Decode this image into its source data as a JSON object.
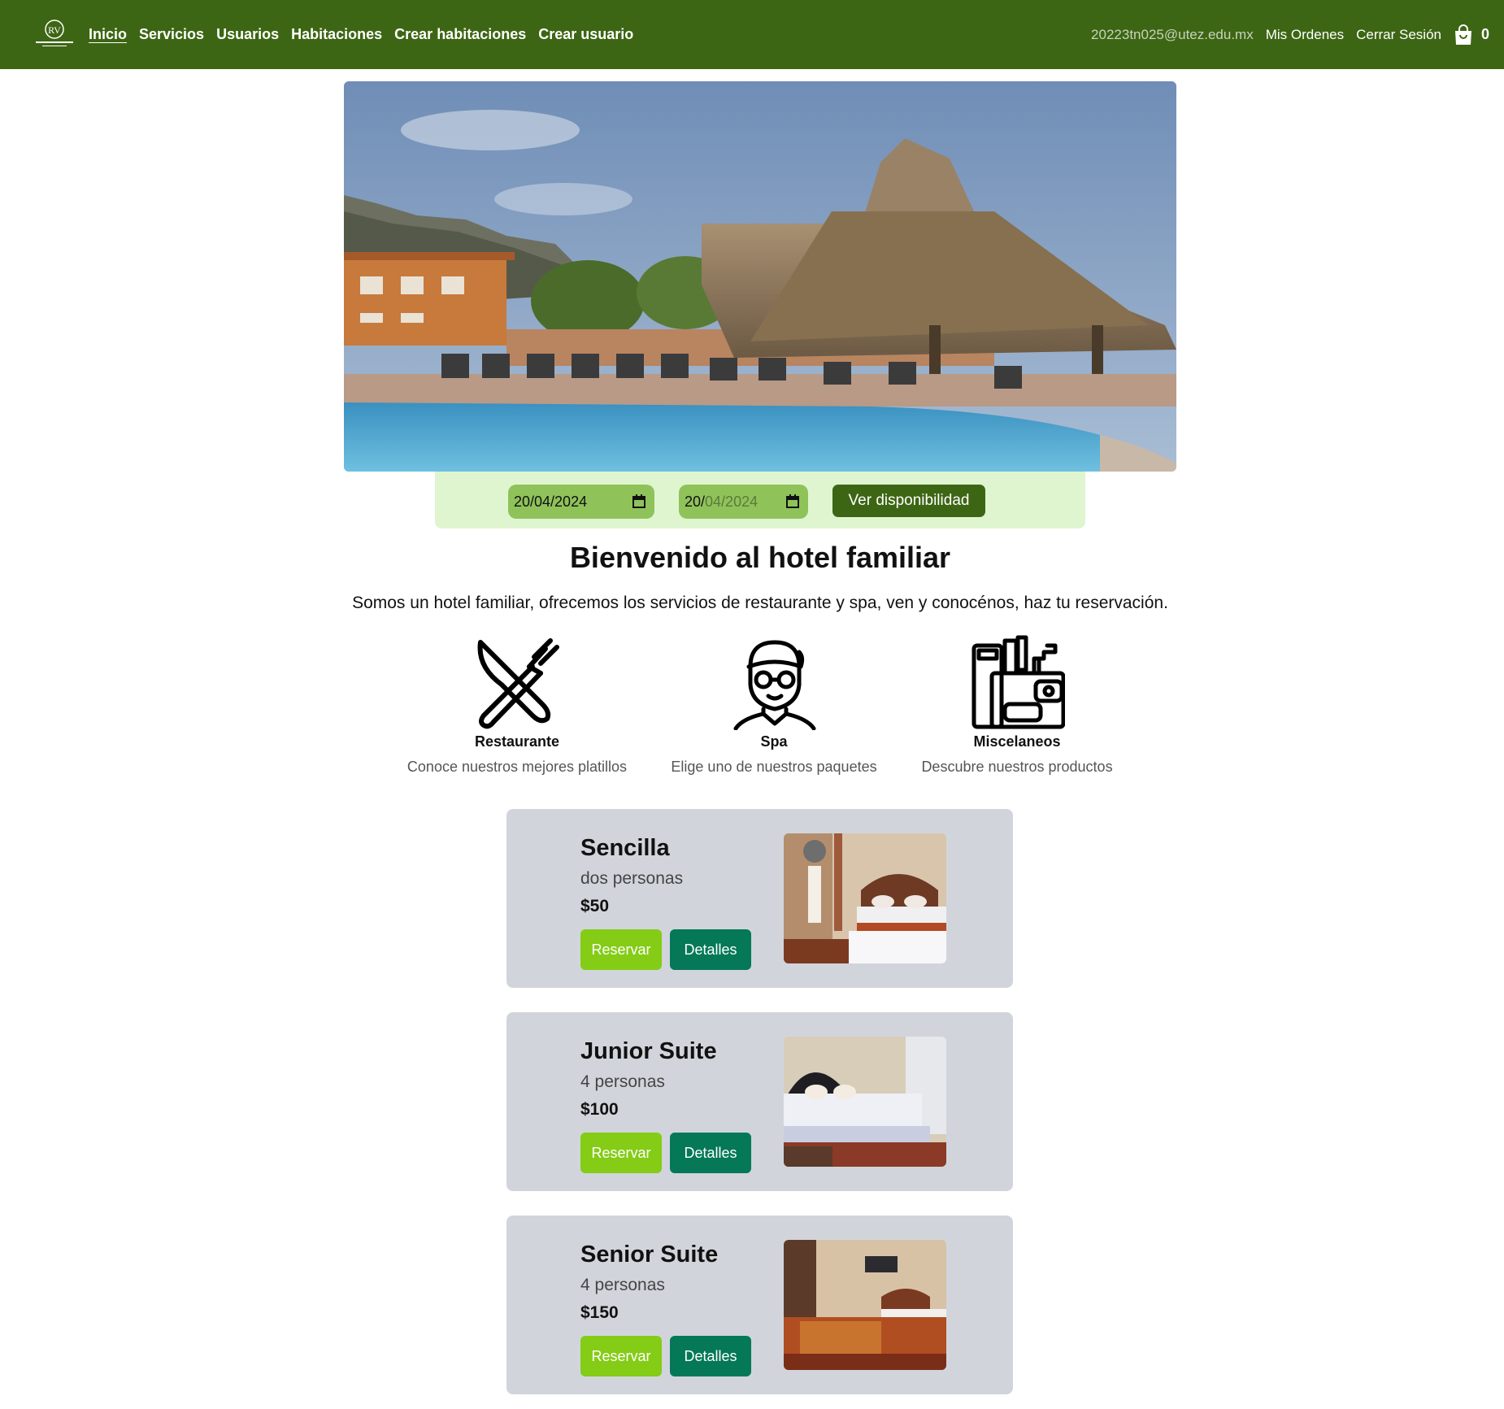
{
  "nav": {
    "links": [
      "Inicio",
      "Servicios",
      "Usuarios",
      "Habitaciones",
      "Crear habitaciones",
      "Crear usuario"
    ],
    "active": "Inicio",
    "email": "20223tn025@utez.edu.mx",
    "orders": "Mis Ordenes",
    "logout": "Cerrar Sesión",
    "cart_count": "0",
    "cart_icon": "shopping-bag-icon"
  },
  "hero": {
    "image": "hotel-pool-palapa-photo"
  },
  "booking": {
    "check_in": "20/04/2024",
    "check_out_day": "20/",
    "check_out_rest": "04/2024",
    "button": "Ver disponibilidad"
  },
  "welcome": {
    "title": "Bienvenido al hotel familiar",
    "text": "Somos un hotel familiar, ofrecemos los servicios de restaurante y spa, ven y conocénos, haz tu reservación."
  },
  "services": [
    {
      "name": "Restaurante",
      "desc": "Conoce nuestros mejores platillos",
      "icon": "fork-knife-icon"
    },
    {
      "name": "Spa",
      "desc": "Elige uno de nuestros paquetes",
      "icon": "spa-face-icon"
    },
    {
      "name": "Miscelaneos",
      "desc": "Descubre nuestros productos",
      "icon": "toiletries-icon"
    }
  ],
  "rooms": [
    {
      "name": "Sencilla",
      "capacity": "dos personas",
      "price": "$50",
      "reserve": "Reservar",
      "details": "Detalles"
    },
    {
      "name": "Junior Suite",
      "capacity": "4 personas",
      "price": "$100",
      "reserve": "Reservar",
      "details": "Detalles"
    },
    {
      "name": "Senior Suite",
      "capacity": "4 personas",
      "price": "$150",
      "reserve": "Reservar",
      "details": "Detalles"
    }
  ],
  "colors": {
    "navbar": "#3d6614",
    "date_bar": "#dff5cf",
    "date_input": "#8fc35a",
    "reserve": "#84cc16",
    "details": "#047857",
    "card": "#d1d5db"
  }
}
